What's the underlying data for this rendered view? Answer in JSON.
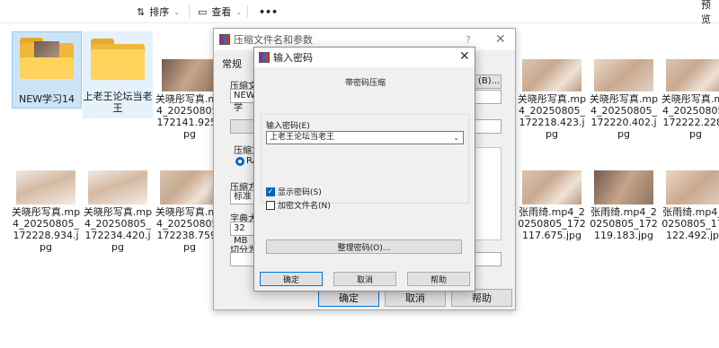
{
  "toolbar": {
    "sort_label": "排序",
    "view_label": "查看",
    "more_label": "•••",
    "preview_label": "预览"
  },
  "files": [
    {
      "name": "NEW学习14",
      "type": "folder"
    },
    {
      "name": "上老王论坛当老王",
      "type": "folder"
    },
    {
      "name": "关晓彤写真.mp4_20250805_172141.925.jpg",
      "type": "image"
    },
    {
      "name": "关晓彤写真.mp4_20250805_172218.423.jpg",
      "type": "image"
    },
    {
      "name": "关晓彤写真.mp4_20250805_172220.402.jpg",
      "type": "image"
    },
    {
      "name": "关晓彤写真.mp4_20250805_172222.228.jpg",
      "type": "image"
    },
    {
      "name": "关晓彤写真.mp4_20250805_172228.934.jpg",
      "type": "image"
    },
    {
      "name": "关晓彤写真.mp4_20250805_172234.420.jpg",
      "type": "image"
    },
    {
      "name": "关晓彤写真.mp4_20250805_172238.759.jpg",
      "type": "image"
    },
    {
      "name": "张雨绮.mp4_20250805_172117.675.jpg",
      "type": "image"
    },
    {
      "name": "张雨绮.mp4_20250805_172119.183.jpg",
      "type": "image"
    },
    {
      "name": "张雨绮.mp4_20250805_172122.492.jpg",
      "type": "image"
    }
  ],
  "rar_dialog": {
    "title": "压缩文件名和参数",
    "help": "?",
    "close": "✕",
    "tab_general": "常规",
    "archive_name_label": "压缩文",
    "archive_name_value": "NEW学",
    "browse_label": "(B)...",
    "format_label": "压缩文",
    "format_value": "RA",
    "method_label": "压缩方",
    "method_value": "标准",
    "dict_label": "字典大",
    "dict_value": "32 MB",
    "split_label": "切分为",
    "ok": "确定",
    "cancel": "取消",
    "help_btn": "帮助"
  },
  "pw_dialog": {
    "title": "输入密码",
    "close": "✕",
    "subtitle": "带密码压缩",
    "enter_label": "输入密码(E)",
    "password_value": "上老王论坛当老王",
    "show_password": "显示密码(S)",
    "show_password_checked": true,
    "encrypt_names": "加密文件名(N)",
    "encrypt_names_checked": false,
    "organize": "整理密码(O)...",
    "ok": "确定",
    "cancel": "取消",
    "help": "帮助"
  }
}
